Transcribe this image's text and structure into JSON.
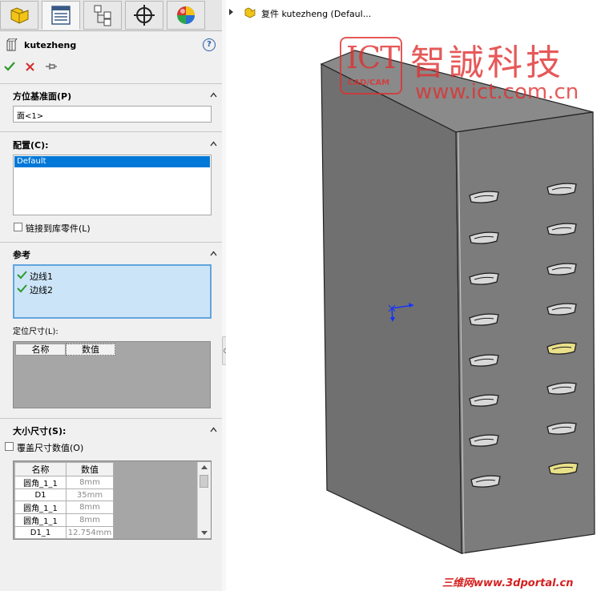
{
  "tabs": [
    {
      "name": "feature-manager",
      "icon": "part-icon"
    },
    {
      "name": "property-manager",
      "icon": "property-list-icon"
    },
    {
      "name": "configuration-manager",
      "icon": "configuration-tree-icon"
    },
    {
      "name": "dimxpert-manager",
      "icon": "crosshair-icon"
    },
    {
      "name": "display-manager",
      "icon": "appearance-sphere-icon"
    }
  ],
  "panel": {
    "title": "kutezheng",
    "help": "?",
    "accent": "#0078d7"
  },
  "orientation_plane": {
    "title": "方位基准面(P)",
    "value": "面<1>"
  },
  "configuration": {
    "title": "配置(C):",
    "items": [
      "Default"
    ],
    "link_checkbox_label": "链接到库零件(L)"
  },
  "reference": {
    "title": "参考",
    "items": [
      "边线1",
      "边线2"
    ],
    "locating_label": "定位尺寸(L):",
    "locating_headers": [
      "名称",
      "数值"
    ]
  },
  "size": {
    "title": "大小尺寸(S):",
    "override_label": "覆盖尺寸数值(O)",
    "headers": [
      "名称",
      "数值"
    ],
    "rows": [
      {
        "name": "圆角_1_1",
        "value": "8mm"
      },
      {
        "name": "D1",
        "value": "35mm"
      },
      {
        "name": "圆角_1_1",
        "value": "8mm"
      },
      {
        "name": "圆角_1_1",
        "value": "8mm"
      },
      {
        "name": "D1_1",
        "value": "12.754mm"
      }
    ]
  },
  "viewport": {
    "tree_label": "复件 kutezheng  (Defaul..."
  },
  "watermark": {
    "logo_text": "ICT",
    "logo_sub": "CAD/CAM",
    "company": "智誠科技",
    "url": "www.ict.com.cn",
    "footer": "三维网www.3dportal.cn",
    "color": "#e03030"
  }
}
